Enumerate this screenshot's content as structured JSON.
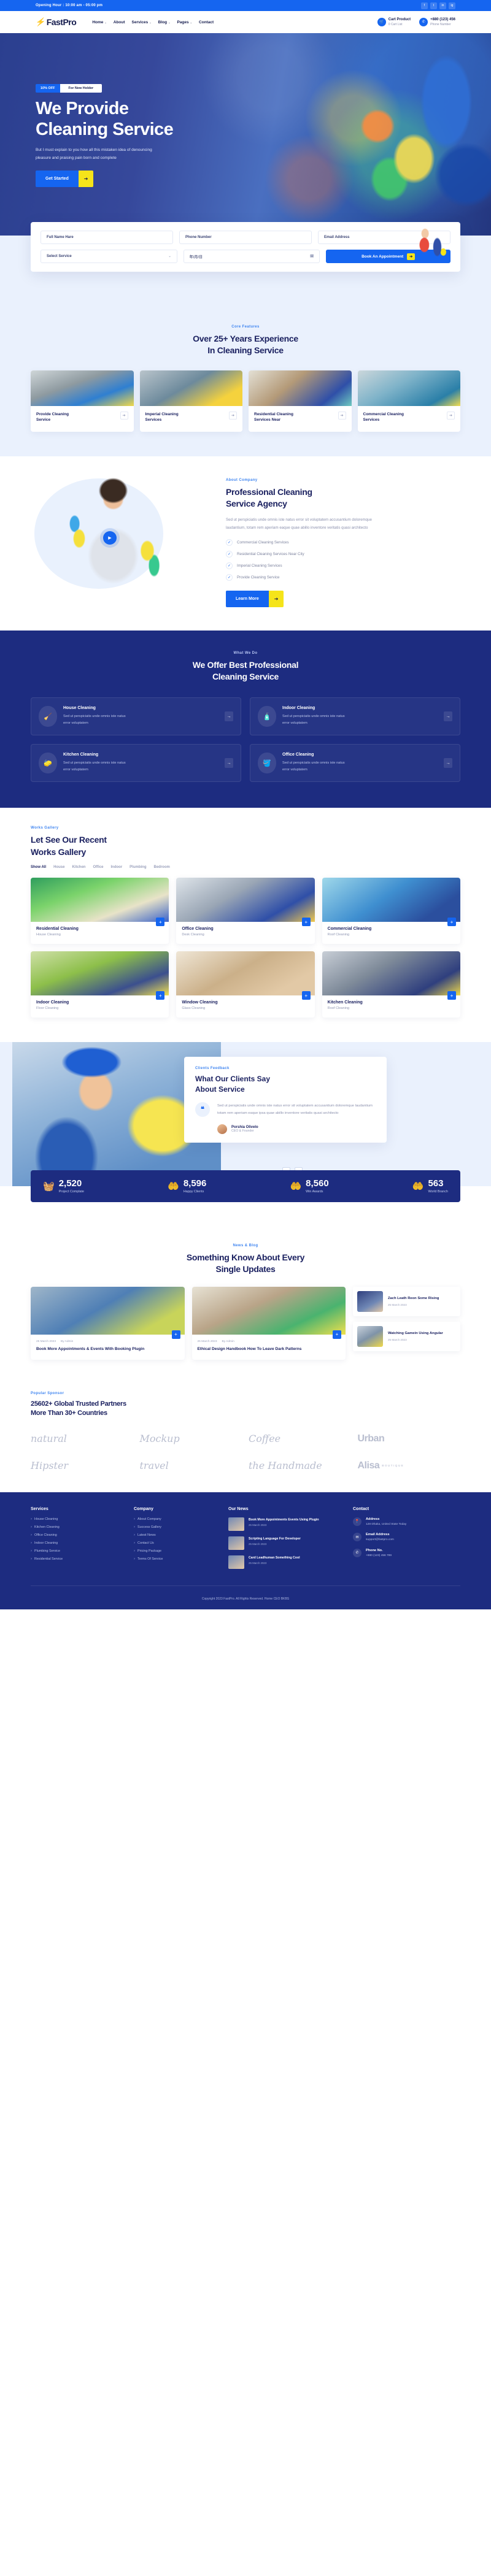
{
  "topbar": {
    "hours": "Opening Hour : 10:00 am - 05:00 pm",
    "socials": [
      "facebook-icon",
      "twitter-icon",
      "linkedin-icon",
      "instagram-icon"
    ],
    "social_glyphs": [
      "f",
      "t",
      "in",
      "ig"
    ]
  },
  "header": {
    "logo_mark": "⚡",
    "logo_text": "FastPro",
    "nav": [
      {
        "label": "Home",
        "caret": "⌄"
      },
      {
        "label": "About",
        "caret": ""
      },
      {
        "label": "Services",
        "caret": "⌄"
      },
      {
        "label": "Blog",
        "caret": "⌄"
      },
      {
        "label": "Pages",
        "caret": "⌄"
      },
      {
        "label": "Contact",
        "caret": ""
      }
    ],
    "cart": {
      "icon": "cart-icon",
      "glyph": "🛒",
      "title": "Cart Product",
      "sub": "0 Cart List"
    },
    "phone": {
      "icon": "phone-icon",
      "glyph": "✆",
      "title": "+880 (123) 456",
      "sub": "Phone Number"
    }
  },
  "hero": {
    "badge_off": "10% OFF",
    "badge_text": "For New Holder",
    "title_line1": "We Provide",
    "title_line2": "Cleaning Service",
    "paragraph": "But I must explain to you how all this mistaken idea of denouncing pleasure and praising pain born and complete",
    "cta_label": "Get Started",
    "cta_arrow": "➔"
  },
  "booking": {
    "fields": [
      {
        "name": "full-name",
        "placeholder": "Full Name Hare"
      },
      {
        "name": "phone-number",
        "placeholder": "Phone Number"
      },
      {
        "name": "email-address",
        "placeholder": "Email Address"
      }
    ],
    "select_service": {
      "label": "Select Service",
      "caret": "⌄"
    },
    "date": {
      "value": "年/月/日",
      "icon": "calendar-icon",
      "glyph": "🗓"
    },
    "submit_label": "Book An Appointment",
    "submit_arrow": "➔"
  },
  "features": {
    "label": "Core Features",
    "title_line1": "Over 25+ Years Experience",
    "title_line2": "In Cleaning Service",
    "cards": [
      {
        "title": "Provide Cleaning Service",
        "arrow": "➔",
        "thumb": "th1"
      },
      {
        "title": "Imperial Cleaning Services",
        "arrow": "➔",
        "thumb": "th2"
      },
      {
        "title": "Residential Cleaning Services Near",
        "arrow": "➔",
        "thumb": "th3"
      },
      {
        "title": "Commercial Cleaning Services",
        "arrow": "➔",
        "thumb": "th4"
      }
    ]
  },
  "about": {
    "label": "About Company",
    "title_line1": "Professional Cleaning",
    "title_line2": "Service Agency",
    "paragraph": "Sed ut perspiciatis unde omnis iste natus error sit voluptatem accusantium doloremque laudantium, totam rem aperiam eaque quae abillo inventore veritatis quasi architecto",
    "play_glyph": "▶",
    "checklist": [
      "Commercial Cleaning Services",
      "Residential Cleaning Services Near City",
      "Imperial Cleaning Services",
      "Provide Cleaning Service"
    ],
    "check_glyph": "✓",
    "cta_label": "Learn More",
    "cta_arrow": "➔"
  },
  "whatwedo": {
    "label": "What We Do",
    "title_line1": "We Offer Best Professional",
    "title_line2": "Cleaning Service",
    "cards": [
      {
        "title": "House Cleaning",
        "desc": "Sed ut perspiciatis unde omnis iste natus error voluptatem",
        "icon": "broom-icon",
        "glyph": "🧹",
        "arrow": "→"
      },
      {
        "title": "Indoor Cleaning",
        "desc": "Sed ut perspiciatis unde omnis iste natus error voluptatem",
        "icon": "spray-bottle-icon",
        "glyph": "🧴",
        "arrow": "→"
      },
      {
        "title": "Kitchen Cleaning",
        "desc": "Sed ut perspiciatis unde omnis iste natus error voluptatem",
        "icon": "sponge-icon",
        "glyph": "🧽",
        "arrow": "→"
      },
      {
        "title": "Office Cleaning",
        "desc": "Sed ut perspiciatis unde omnis iste natus error voluptatem",
        "icon": "bucket-icon",
        "glyph": "🪣",
        "arrow": "→"
      }
    ]
  },
  "gallery": {
    "label": "Works Gallery",
    "title_line1": "Let See Our Recent",
    "title_line2": "Works Gallery",
    "filters": [
      "Show All",
      "House",
      "Kitchen",
      "Office",
      "Indoor",
      "Plumbing",
      "Bedroom"
    ],
    "active_filter": "Show All",
    "plus": "+",
    "items": [
      {
        "title": "Residential Cleaning",
        "sub": "House Cleaning",
        "thumb": "g1"
      },
      {
        "title": "Office Cleaning",
        "sub": "Desk Cleaning",
        "thumb": "g2"
      },
      {
        "title": "Commercial Cleaning",
        "sub": "Roof Cleaning",
        "thumb": "g3"
      },
      {
        "title": "Indoor Cleaning",
        "sub": "Floor Cleaning",
        "thumb": "g4"
      },
      {
        "title": "Window Cleaning",
        "sub": "Glass Cleaning",
        "thumb": "g5"
      },
      {
        "title": "Kitchen Cleaning",
        "sub": "Roof Cleaning",
        "thumb": "g6"
      }
    ]
  },
  "testimonial": {
    "label": "Clients Feedback",
    "title_line1": "What Our Clients Say",
    "title_line2": "About Service",
    "quote_mark": "❝",
    "quote": "Sed ut perspiciatis unde omnis iste natus error sit voluptatem accusantium doloremque laudantium totam rem aperiam eaque ipsa quae abillo inventore veritatis quasi architecto",
    "person_name": "Porshia Olivelo",
    "person_role": "CEO & Founder",
    "prev": "‹",
    "next": "›"
  },
  "stats": [
    {
      "icon": "cleaning-kit-icon",
      "glyph": "🧺",
      "number": "2,520",
      "label": "Project Complate"
    },
    {
      "icon": "hand-heart-icon",
      "glyph": "🤲",
      "number": "8,596",
      "label": "Happy Clients"
    },
    {
      "icon": "hand-award-icon",
      "glyph": "🤲",
      "number": "8,560",
      "label": "Win Awards"
    },
    {
      "icon": "hand-globe-icon",
      "glyph": "🤲",
      "number": "563",
      "label": "World Branch"
    }
  ],
  "blog": {
    "label": "News & Blog",
    "title_line1": "Something Know About Every",
    "title_line2": "Single Updates",
    "plus": "+",
    "posts": [
      {
        "date": "25 March 2023",
        "author": "By Admin",
        "title": "Book More Appointments & Events With Booking Plugin",
        "thumb": "bb1"
      },
      {
        "date": "25 March 2023",
        "author": "By Admin",
        "title": "Ethical Design Handbook How To Leave Dark Patterns",
        "thumb": "bb2"
      }
    ],
    "side_posts": [
      {
        "title": "Zach Leath Reon Some Rising",
        "date": "25 March 2023",
        "thumb": "sb1"
      },
      {
        "title": "Watching Gamein Using Angular",
        "date": "25 March 2023",
        "thumb": "sb2"
      }
    ]
  },
  "partners": {
    "label": "Popular Sponsor",
    "title_line1": "25602+ Global Trusted Partners",
    "title_line2": "More Than 30+ Countries",
    "logos": [
      {
        "text": "natural",
        "style": "script",
        "sub": ""
      },
      {
        "text": "Mockup",
        "style": "script",
        "sub": ""
      },
      {
        "text": "Coffee",
        "style": "script",
        "sub": ""
      },
      {
        "text": "Urban",
        "style": "bold",
        "sub": ""
      },
      {
        "text": "Hipster",
        "style": "script",
        "sub": ""
      },
      {
        "text": "travel",
        "style": "script",
        "sub": ""
      },
      {
        "text": "the Handmade",
        "style": "script",
        "sub": ""
      },
      {
        "text": "Alisa",
        "style": "bold",
        "sub": "BOUTIQUE"
      }
    ]
  },
  "footer": {
    "columns": [
      {
        "title": "Services",
        "items": [
          "House Cleaning",
          "Kitchen Cleaning",
          "Office Cleaning",
          "Indoor Cleaning",
          "Plumbing Service",
          "Residential Service"
        ]
      },
      {
        "title": "Company",
        "items": [
          "About Company",
          "Success Gallery",
          "Latest News",
          "Contact Us",
          "Pricing Package",
          "Terms Of Service"
        ]
      }
    ],
    "news": {
      "title": "Our News",
      "items": [
        {
          "title": "Book More Appointments Events Using Plugin",
          "date": "25 March 2023"
        },
        {
          "title": "Scripting Language For Developer",
          "date": "25 March 2023"
        },
        {
          "title": "Card Leadhuman Something Cool",
          "date": "25 March 2023"
        }
      ]
    },
    "contact": {
      "title": "Contact",
      "items": [
        {
          "icon": "location-icon",
          "glyph": "📍",
          "label": "Address",
          "value": "128 Dhaka, United State Today"
        },
        {
          "icon": "mail-icon",
          "glyph": "✉",
          "label": "Email Address",
          "value": "support@fastpro.com"
        },
        {
          "icon": "phone-icon",
          "glyph": "✆",
          "label": "Phone No.",
          "value": "+880 (123) 456 789"
        }
      ]
    },
    "copyright": "Copyright 2023 FastPro. All Rights Reserved. Home CEO BKBS"
  }
}
